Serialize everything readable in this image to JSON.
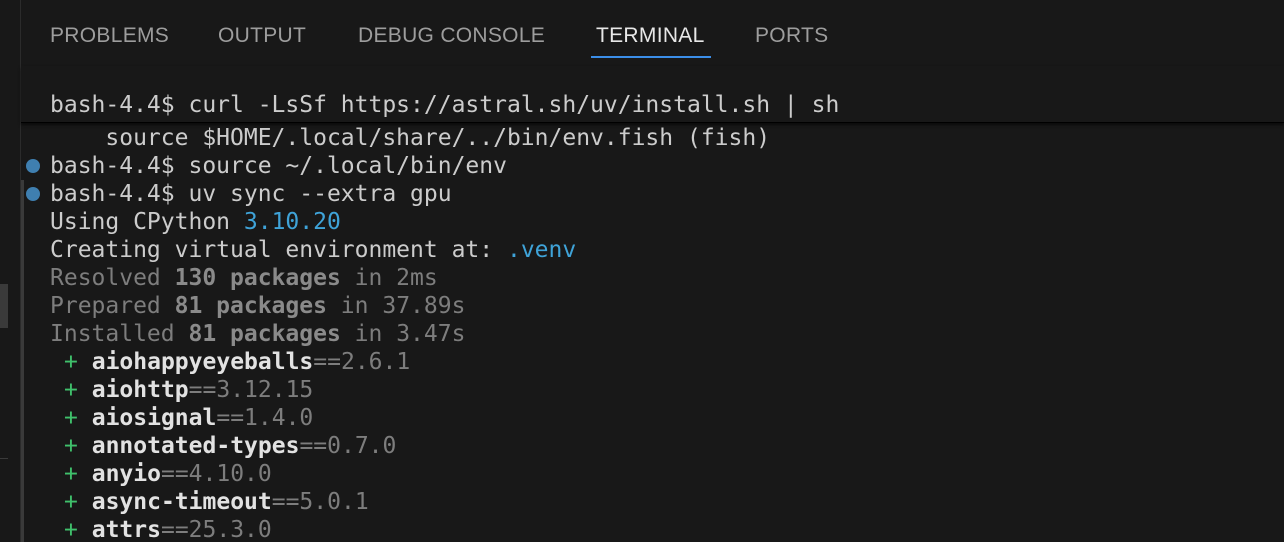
{
  "tabs": [
    {
      "label": "PROBLEMS"
    },
    {
      "label": "OUTPUT"
    },
    {
      "label": "DEBUG CONSOLE"
    },
    {
      "label": "TERMINAL",
      "active": true
    },
    {
      "label": "PORTS"
    }
  ],
  "terminal": {
    "sticky_command": "bash-4.4$ curl -LsSf https://astral.sh/uv/install.sh | sh",
    "partial_line": "    source $HOME/.local/share/../bin/env.fish (fish)",
    "cmd1": "bash-4.4$ source ~/.local/bin/env",
    "cmd2": "bash-4.4$ uv sync --extra gpu",
    "using_prefix": "Using CPython ",
    "using_version": "3.10.20",
    "creating_prefix": "Creating virtual environment at: ",
    "creating_path": ".venv",
    "resolved": {
      "pre": "Resolved ",
      "count": "130 packages",
      "post": " in 2ms"
    },
    "prepared": {
      "pre": "Prepared ",
      "count": "81 packages",
      "post": " in 37.89s"
    },
    "installed": {
      "pre": "Installed ",
      "count": "81 packages",
      "post": " in 3.47s"
    },
    "plus": "+",
    "packages": [
      {
        "name": "aiohappyeyeballs",
        "version": "==2.6.1"
      },
      {
        "name": "aiohttp",
        "version": "==3.12.15"
      },
      {
        "name": "aiosignal",
        "version": "==1.4.0"
      },
      {
        "name": "annotated-types",
        "version": "==0.7.0"
      },
      {
        "name": "anyio",
        "version": "==4.10.0"
      },
      {
        "name": "async-timeout",
        "version": "==5.0.1"
      },
      {
        "name": "attrs",
        "version": "==25.3.0"
      }
    ]
  },
  "colors": {
    "background": "#181818",
    "accent": "#3b8ee8",
    "command_dot": "#3f7fb0",
    "version_blue": "#3fa3d8",
    "plus_green": "#3fc06b"
  }
}
